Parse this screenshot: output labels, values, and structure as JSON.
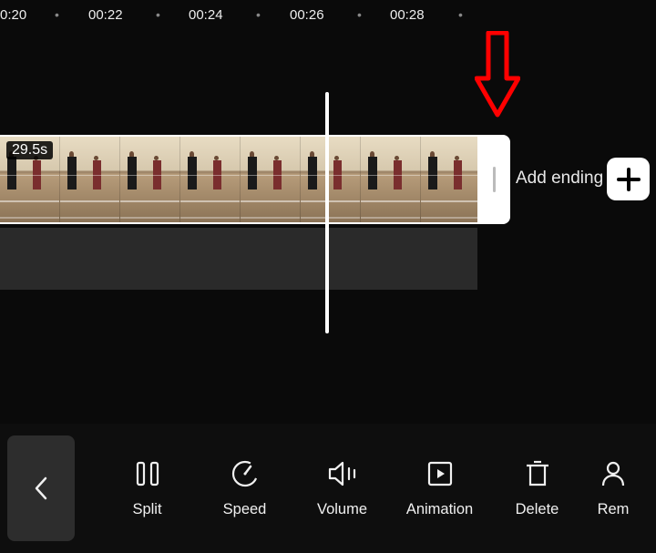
{
  "ruler": {
    "ticks": [
      "0:20",
      "00:22",
      "00:24",
      "00:26",
      "00:28"
    ]
  },
  "clip": {
    "duration_label": "29.5s"
  },
  "add_ending": {
    "label": "Add ending"
  },
  "toolbar": {
    "tools": [
      {
        "id": "split",
        "label": "Split"
      },
      {
        "id": "speed",
        "label": "Speed"
      },
      {
        "id": "volume",
        "label": "Volume"
      },
      {
        "id": "animation",
        "label": "Animation"
      },
      {
        "id": "delete",
        "label": "Delete"
      },
      {
        "id": "removebg",
        "label": "Rem"
      }
    ]
  }
}
